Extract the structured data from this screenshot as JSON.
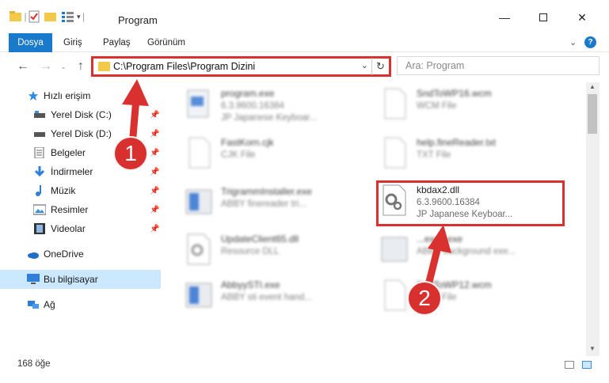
{
  "window": {
    "title": "Program"
  },
  "ribbon": {
    "tabs": [
      "Dosya",
      "Giriş",
      "Paylaş",
      "Görünüm"
    ]
  },
  "address": {
    "path": "C:\\Program Files\\Program Dizini"
  },
  "search": {
    "placeholder": "Ara: Program"
  },
  "sidebar": {
    "items": [
      {
        "label": "Hızlı erişim",
        "icon": "star-icon"
      },
      {
        "label": "Yerel Disk (C:)",
        "icon": "drive-icon",
        "pinned": true
      },
      {
        "label": "Yerel Disk (D:)",
        "icon": "drive-icon",
        "pinned": true
      },
      {
        "label": "Belgeler",
        "icon": "documents-icon",
        "pinned": true
      },
      {
        "label": "İndirmeler",
        "icon": "download-icon",
        "pinned": true
      },
      {
        "label": "Müzik",
        "icon": "music-icon",
        "pinned": true
      },
      {
        "label": "Resimler",
        "icon": "pictures-icon",
        "pinned": true
      },
      {
        "label": "Videolar",
        "icon": "videos-icon",
        "pinned": true
      },
      {
        "label": "OneDrive",
        "icon": "onedrive-icon"
      },
      {
        "label": "Bu bilgisayar",
        "icon": "computer-icon",
        "selected": true
      },
      {
        "label": "Ağ",
        "icon": "network-icon"
      }
    ]
  },
  "files": [
    {
      "name": "program.exe",
      "line1": "6.3.9600.16384",
      "line2": "JP Japanese Keyboar..."
    },
    {
      "name": "SndToWP16.wcm",
      "line1": "WCM File",
      "line2": ""
    },
    {
      "name": "FastKorn.cjk",
      "line1": "CJK File",
      "line2": ""
    },
    {
      "name": "help.fineReader.txt",
      "line1": "TXT File",
      "line2": ""
    },
    {
      "name": "TrigrammInstaller.exe",
      "line1": "ABBY finereader tri...",
      "line2": ""
    },
    {
      "name": "kbdax2.dll",
      "line1": "6.3.9600.16384",
      "line2": "JP Japanese Keyboar..."
    },
    {
      "name": "UpdateClient65.dll",
      "line1": "Resource DLL",
      "line2": ""
    },
    {
      "name": "...exec.exe",
      "line1": "ABBY background exe...",
      "line2": ""
    },
    {
      "name": "AbbyySTI.exe",
      "line1": "ABBY sti event hand...",
      "line2": ""
    },
    {
      "name": "SndToWP12.wcm",
      "line1": "WCM File",
      "line2": ""
    }
  ],
  "status": {
    "count": "168 öğe"
  },
  "annotations": {
    "badge1": "1",
    "badge2": "2"
  },
  "colors": {
    "accent": "#1979ca",
    "highlight": "#d9312f",
    "selected": "#cce8ff"
  }
}
